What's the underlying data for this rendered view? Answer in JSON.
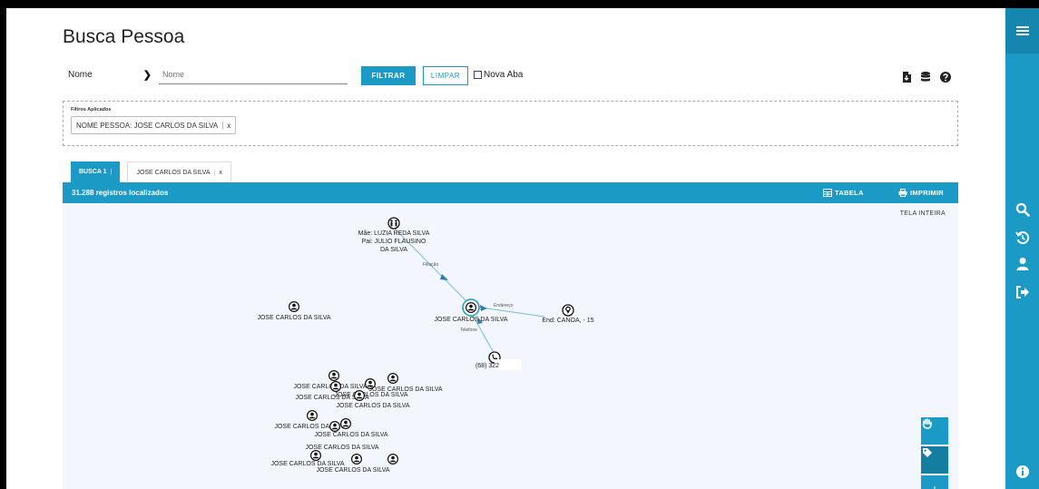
{
  "page": {
    "title": "Busca Pessoa"
  },
  "filter_bar": {
    "field_select": "Nome",
    "search_placeholder": "Nome",
    "filtrar_label": "FILTRAR",
    "limpar_label": "LIMPAR",
    "nova_aba_label": "Nova Aba",
    "nova_aba_checked": false
  },
  "applied_filters": {
    "label": "Filtros Aplicados",
    "chips": [
      {
        "text": "NOME PESSOA: JOSE CARLOS DA SILVA",
        "remove": "x"
      }
    ]
  },
  "tabs": [
    {
      "label": "BUSCA 1",
      "active": true
    },
    {
      "label": "JOSE CARLOS DA SILVA",
      "close": "x",
      "active": false
    }
  ],
  "results": {
    "count_text": "31.288 registros localizados",
    "tabela_label": "TABELA",
    "imprimir_label": "IMPRIMIR"
  },
  "graph": {
    "tela_inteira": "TELA INTEIRA",
    "center": {
      "label": "JOSE CARLOS DA SILVA",
      "icon": "person-icon"
    },
    "parents": {
      "lines": [
        "Mãe: LUZIA REDA SILVA",
        "Pai: JULIO FLAUSINO",
        "DA SILVA"
      ],
      "icon": "family-icon",
      "edge_label": "Filiação"
    },
    "address": {
      "label": "End: CANOA, - 15",
      "icon": "location-icon",
      "edge_label": "Endereço"
    },
    "phone": {
      "label": "(68) 322",
      "icon": "phone-icon",
      "edge_label": "Telefone"
    },
    "other_nodes": [
      "JOSE CARLOS DA SILVA",
      "JOSE CARLOS DA SILVA",
      "JOSE CARLOS DA SILVA",
      "JOSE CARLOS DA SILVA",
      "JOSE CARLOS DA SILVA",
      "JOSE CARLOS DA SILVA",
      "JOSE CARLOS DA SILVA",
      "JOSE CARLOS DA SILVA",
      "JOSE CARLOS DA SILVA",
      "JOSE CARLOS DA SILVA",
      "JOSE CARLOS DA SILVA"
    ],
    "tools": [
      "hand-icon",
      "tag-icon",
      "plus-icon"
    ]
  },
  "sidebar_icons": [
    "menu-icon",
    "search-icon",
    "history-icon",
    "user-icon",
    "logout-icon",
    "info-icon"
  ],
  "colors": {
    "accent": "#1a9ac4",
    "graph_bg": "#f3f6fc",
    "edge": "#5ba8c9"
  }
}
